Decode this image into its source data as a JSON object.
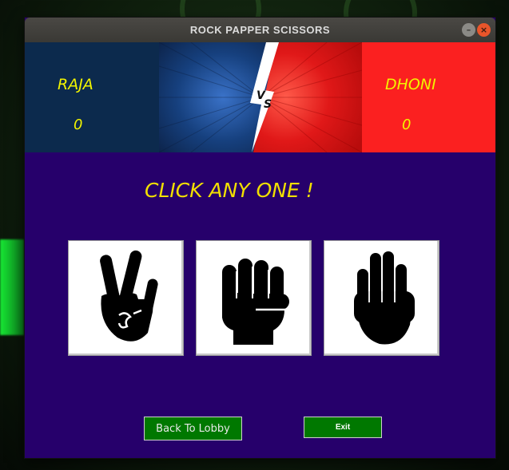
{
  "window": {
    "title": "ROCK PAPPER SCISSORS",
    "minimize_glyph": "–",
    "close_glyph": "×"
  },
  "players": {
    "left": {
      "name": "RAJA",
      "score": "0"
    },
    "right": {
      "name": "DHONI",
      "score": "0"
    }
  },
  "versus": {
    "letter1": "V",
    "letter2": "S"
  },
  "prompt": "CLICK ANY ONE !",
  "choices": [
    {
      "icon": "scissors-hand-icon"
    },
    {
      "icon": "rock-fist-icon"
    },
    {
      "icon": "paper-palm-icon"
    }
  ],
  "buttons": {
    "back_to_lobby": "Back To Lobby",
    "exit": "Exit"
  },
  "colors": {
    "game_background": "#26006b",
    "left_panel": "#0c2a4d",
    "right_panel": "#fb2020",
    "player_text": "#f2f400",
    "button_green": "#007800"
  }
}
